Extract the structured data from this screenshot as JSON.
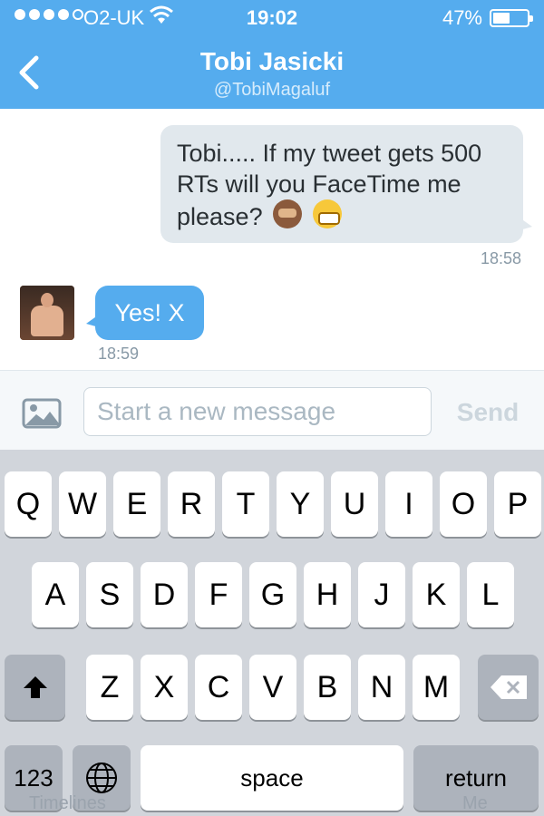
{
  "status_bar": {
    "carrier": "O2-UK",
    "time": "19:02",
    "battery_percent": "47%",
    "battery_level": 0.47,
    "signal_bars_filled": 4,
    "signal_bars_total": 5
  },
  "header": {
    "name": "Tobi Jasicki",
    "handle": "@TobiMagaluf",
    "background_color": "#55acee",
    "back_icon": "chevron-left-icon"
  },
  "messages": [
    {
      "direction": "outgoing",
      "text": "Tobi..... If my tweet gets 500 RTs will you FaceTime me please?",
      "emojis": [
        "see-no-evil-monkey-emoji",
        "grinning-face-emoji"
      ],
      "time": "18:58"
    },
    {
      "direction": "incoming",
      "text": "Yes! X",
      "time": "18:59",
      "avatar_icon": "avatar"
    }
  ],
  "composer": {
    "media_icon": "image-icon",
    "placeholder": "Start a new message",
    "send_label": "Send"
  },
  "keyboard": {
    "row1": [
      "Q",
      "W",
      "E",
      "R",
      "T",
      "Y",
      "U",
      "I",
      "O",
      "P"
    ],
    "row2": [
      "A",
      "S",
      "D",
      "F",
      "G",
      "H",
      "J",
      "K",
      "L"
    ],
    "row3": [
      "Z",
      "X",
      "C",
      "V",
      "B",
      "N",
      "M"
    ],
    "shift_icon": "shift-arrow-icon",
    "delete_icon": "backspace-icon",
    "numbers_label": "123",
    "globe_icon": "globe-icon",
    "space_label": "space",
    "return_label": "return"
  },
  "background_tabs": {
    "left_label": "Timelines",
    "right_label": "Me"
  }
}
